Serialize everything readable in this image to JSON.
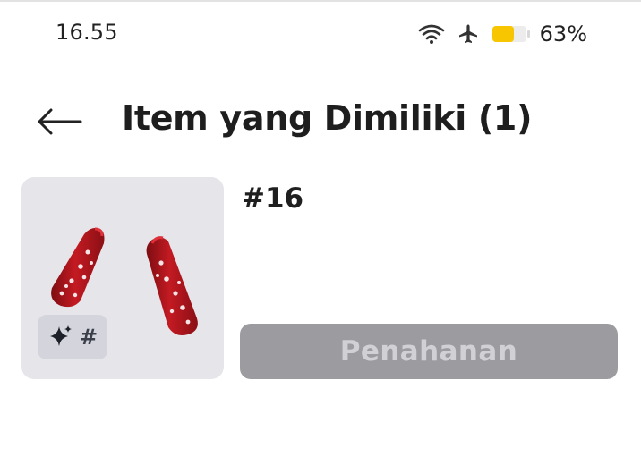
{
  "status_bar": {
    "time": "16.55",
    "battery_percent": "63%",
    "battery_level": 0.63,
    "icons": [
      "wifi-icon",
      "airplane-mode-icon",
      "battery-icon"
    ]
  },
  "header": {
    "back_icon": "back-arrow-icon",
    "title": "Item yang Dimiliki (1)"
  },
  "item": {
    "name": "#16",
    "badge_icon": "sparkle-icon",
    "badge_text": "#",
    "button_label": "Penahanan"
  },
  "colors": {
    "thumb_background": "#e5e5ea",
    "badge_background": "#d3d4dc",
    "button_background": "#9c9ca0",
    "button_text": "#d1d1d5",
    "battery_fill": "#f7c600",
    "item_red": "#b3141c"
  }
}
